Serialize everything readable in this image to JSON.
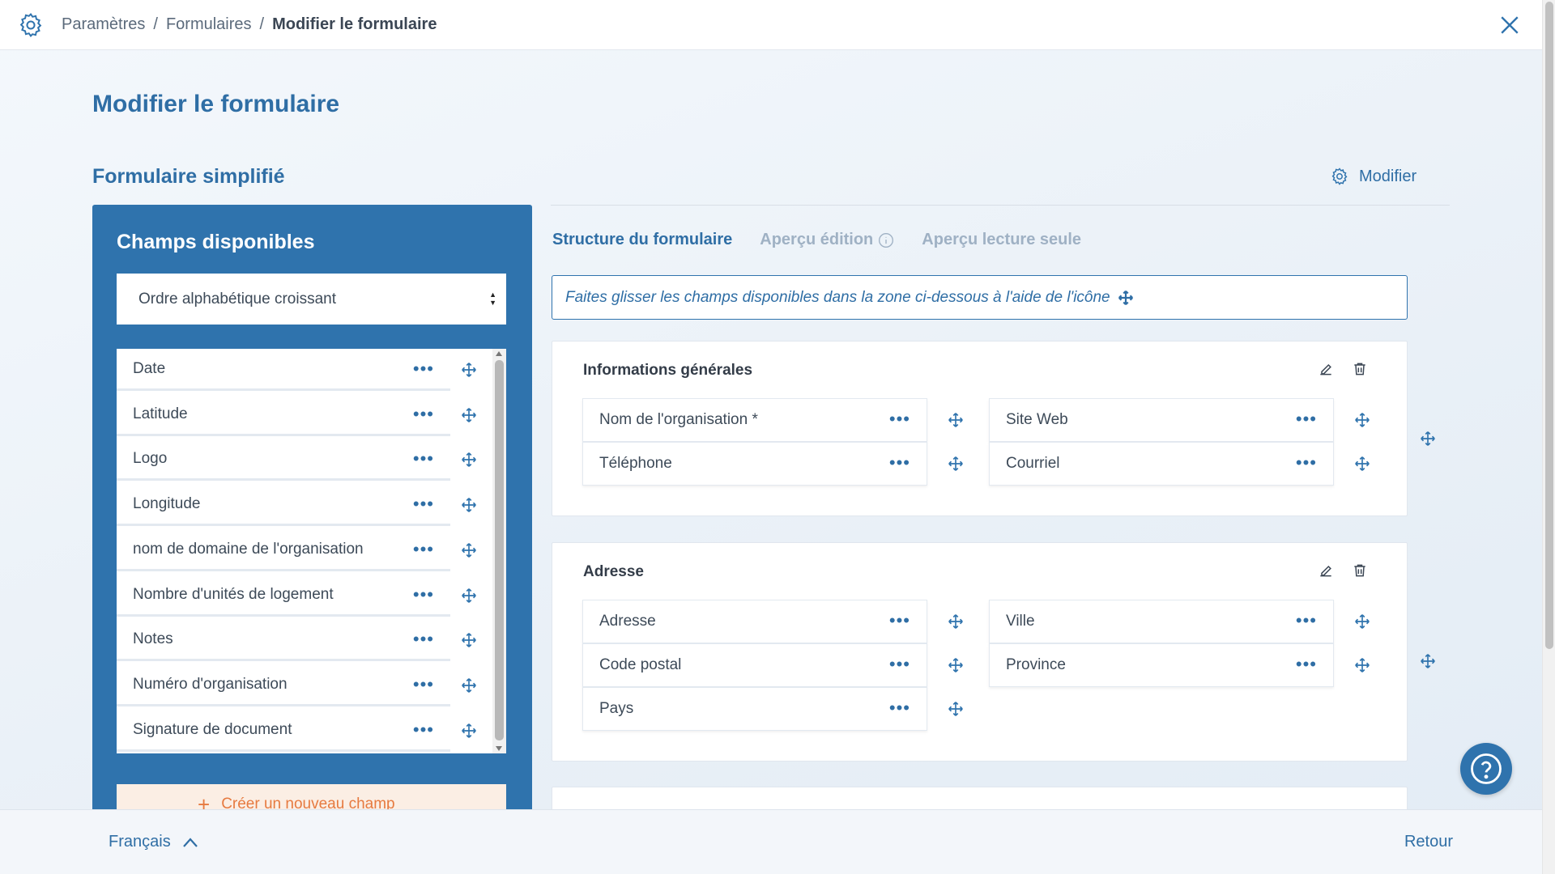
{
  "breadcrumb": {
    "items": [
      "Paramètres",
      "Formulaires"
    ],
    "current": "Modifier le formulaire",
    "separator": "/"
  },
  "page": {
    "title": "Modifier le formulaire",
    "form_name": "Formulaire simplifié",
    "modify_label": "Modifier"
  },
  "available": {
    "title": "Champs disponibles",
    "sort_value": "Ordre alphabétique croissant",
    "fields": [
      "Date",
      "Latitude",
      "Logo",
      "Longitude",
      "nom de domaine de l'organisation",
      "Nombre d'unités de logement",
      "Notes",
      "Numéro d'organisation",
      "Signature de document"
    ],
    "create_label": "Créer un nouveau champ",
    "dots": "•••"
  },
  "tabs": [
    {
      "label": "Structure du formulaire",
      "active": true
    },
    {
      "label": "Aperçu édition",
      "active": false
    },
    {
      "label": "Aperçu lecture seule",
      "active": false
    }
  ],
  "hint": "Faites glisser les champs disponibles dans la zone ci-dessous à l'aide de l'icône",
  "sections": [
    {
      "title": "Informations générales",
      "left": [
        "Nom de l'organisation *",
        "Téléphone"
      ],
      "right": [
        "Site Web",
        "Courriel"
      ]
    },
    {
      "title": "Adresse",
      "left": [
        "Adresse",
        "Code postal",
        "Pays"
      ],
      "right": [
        "Ville",
        "Province"
      ]
    }
  ],
  "footer": {
    "language": "Français",
    "back": "Retour"
  },
  "colors": {
    "primary": "#2f73ad",
    "accent_orange": "#e67a40"
  }
}
